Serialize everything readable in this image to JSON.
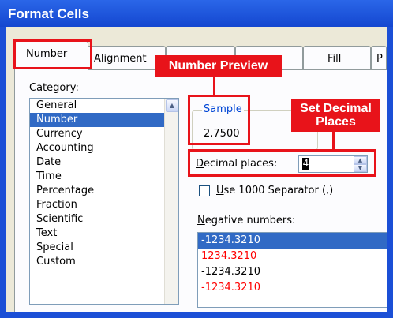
{
  "dialog": {
    "title": "Format Cells"
  },
  "tabs": [
    {
      "label": "Number",
      "active": true
    },
    {
      "label": "Alignment"
    },
    {
      "label": "Fill"
    },
    {
      "label": "P"
    }
  ],
  "category": {
    "label_first": "C",
    "label_rest": "ategory:",
    "items": [
      "General",
      "Number",
      "Currency",
      "Accounting",
      "Date",
      "Time",
      "Percentage",
      "Fraction",
      "Scientific",
      "Text",
      "Special",
      "Custom"
    ],
    "selected": "Number"
  },
  "sample": {
    "legend": "Sample",
    "value": "2.7500"
  },
  "decimal_places": {
    "label_first": "D",
    "label_rest": "ecimal places:",
    "value": "4"
  },
  "separator": {
    "label_first": "U",
    "label_rest": "se 1000 Separator (,)",
    "checked": false
  },
  "negative_numbers": {
    "label_first": "N",
    "label_rest": "egative numbers:",
    "items": [
      {
        "text": "-1234.3210",
        "color": "#000000",
        "selected": true
      },
      {
        "text": "1234.3210",
        "color": "#ff0000"
      },
      {
        "text": "-1234.3210",
        "color": "#000000"
      },
      {
        "text": "-1234.3210",
        "color": "#ff0000"
      }
    ]
  },
  "annotations": {
    "number_preview": "Number Preview",
    "set_decimal_line1": "Set Decimal",
    "set_decimal_line2": "Places",
    "color": "#e8131a"
  },
  "colors": {
    "title_bar": "#1b4fd6",
    "selection": "#316ac5",
    "dialog_bg": "#ece9d8"
  }
}
